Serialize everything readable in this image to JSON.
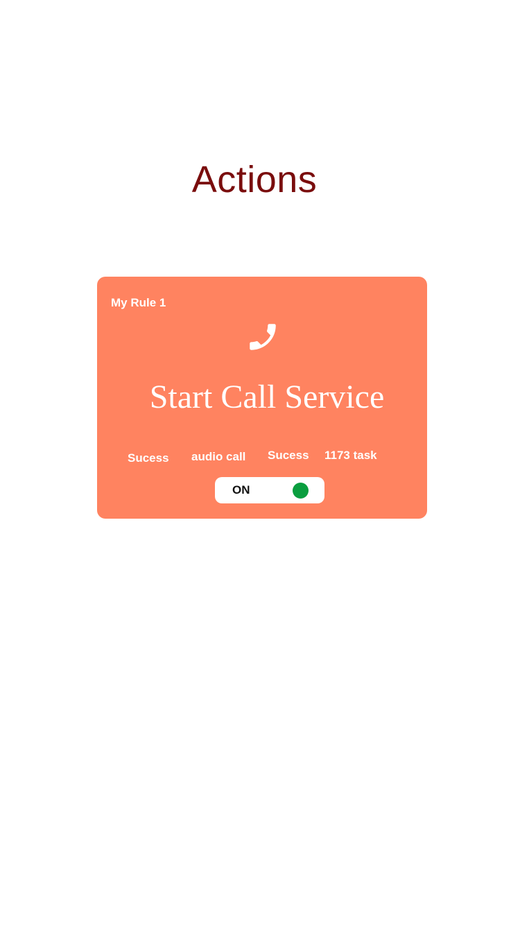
{
  "page": {
    "title": "Actions"
  },
  "card": {
    "rule_name": "My Rule 1",
    "icon": "phone-icon",
    "service_title": "Start Call Service",
    "background_color": "#ff8360",
    "stats": [
      "Sucess",
      "audio call",
      "Sucess",
      "1173 task"
    ],
    "toggle": {
      "label": "ON",
      "state": true,
      "knob_color": "#0a9e3f"
    }
  },
  "colors": {
    "title": "#7a0d0d"
  }
}
